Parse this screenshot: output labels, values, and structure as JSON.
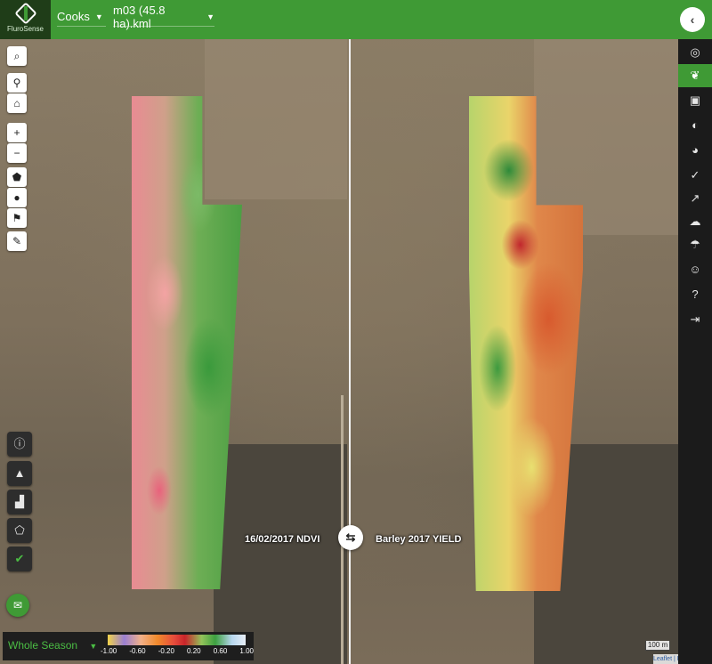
{
  "app": {
    "brand": "FluroSense"
  },
  "header": {
    "farm_select": "Cooks",
    "file_select": "m03 (45.8 ha).kml",
    "collapse_icon": "chevron-left-icon"
  },
  "map": {
    "left_layer_label": "16/02/2017 NDVI",
    "right_layer_label": "Barley 2017 YIELD",
    "swap_icon": "swap-arrows-icon",
    "scale": "100 m",
    "attribution": "Leaflet | FluroSat"
  },
  "toolbar": {
    "top_icons": [
      "search-icon",
      "pin-icon",
      "home-icon",
      "zoom-in-icon",
      "zoom-out-icon",
      "polygon-icon",
      "circle-icon",
      "marker-icon",
      "edit-icon"
    ],
    "bottom_icons": [
      "info-icon",
      "warning-icon",
      "bar-chart-icon",
      "tag-icon",
      "leaf-icon"
    ],
    "chat_icon": "chat-icon"
  },
  "legend": {
    "season": "Whole Season",
    "ticks": [
      "-1.00",
      "-0.60",
      "-0.20",
      "0.20",
      "0.60",
      "1.00"
    ]
  },
  "sidebar": {
    "items": [
      "layers-icon",
      "crop-icon",
      "images-icon",
      "compare-icon",
      "pie-chart-icon",
      "check-badge-icon",
      "trend-icon",
      "weather-icon",
      "irrigation-icon",
      "user-icon",
      "help-icon",
      "logout-icon"
    ],
    "active_index": 1
  },
  "colors": {
    "brand_green": "#3f9a35",
    "sidebar_dark": "#1b1b1b"
  }
}
